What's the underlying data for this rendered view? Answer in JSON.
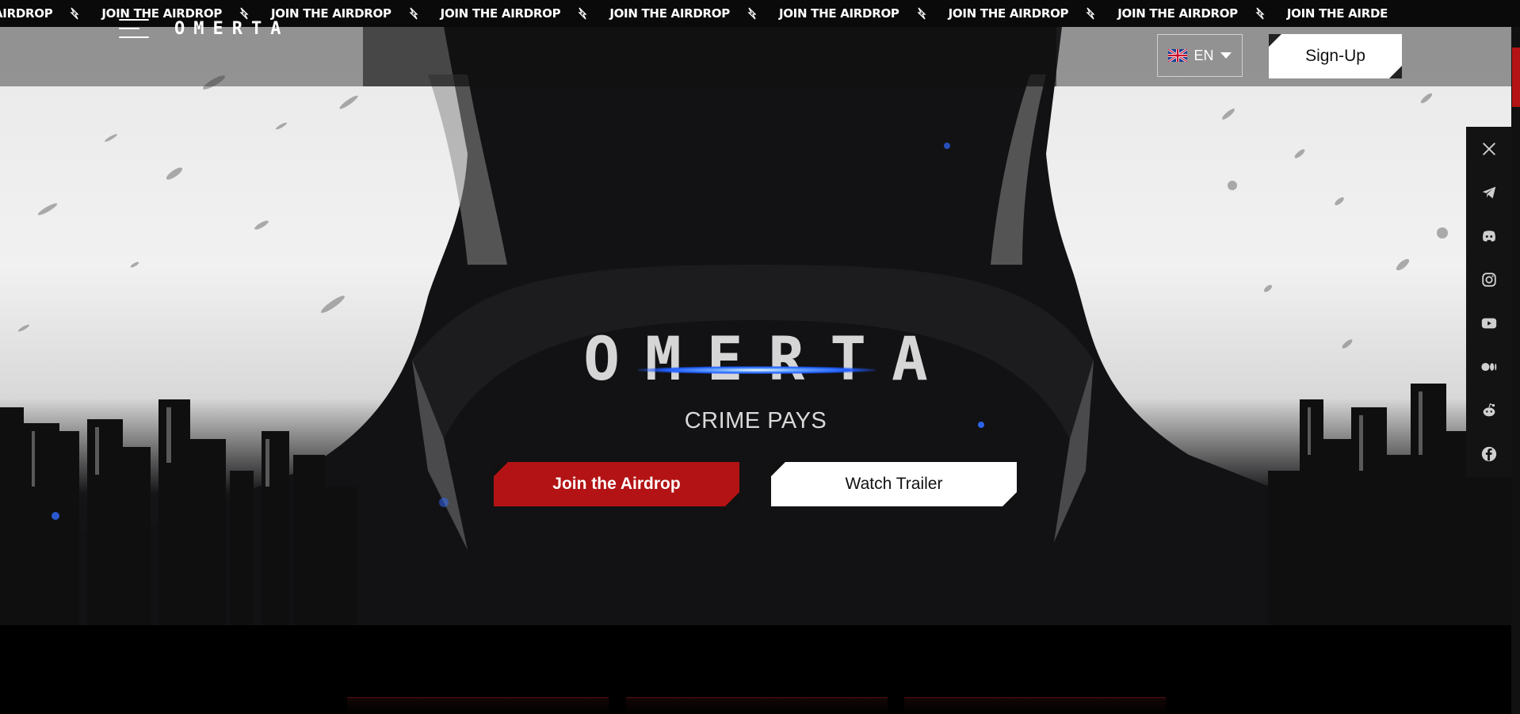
{
  "ticker": {
    "items": [
      {
        "label": "AIRDROP",
        "icon": "bolt-icon"
      },
      {
        "label": "JOIN THE AIRDROP",
        "icon": "bolt-icon"
      },
      {
        "label": "JOIN THE AIRDROP",
        "icon": "bolt-icon"
      },
      {
        "label": "JOIN THE AIRDROP",
        "icon": "bolt-icon"
      },
      {
        "label": "JOIN THE AIRDROP",
        "icon": "bolt-icon"
      },
      {
        "label": "JOIN THE AIRDROP",
        "icon": "bolt-icon"
      },
      {
        "label": "JOIN THE AIRDROP",
        "icon": "bolt-icon"
      },
      {
        "label": "JOIN THE AIRDROP",
        "icon": "bolt-icon"
      },
      {
        "label": "JOIN THE AIRDE"
      }
    ]
  },
  "header": {
    "logo": "OMERTA",
    "language": "EN",
    "language_flag": "uk-flag-icon",
    "signup_label": "Sign-Up"
  },
  "hero": {
    "title": "OMERTA",
    "tagline": "CRIME PAYS",
    "primary_cta": "Join the Airdrop",
    "secondary_cta": "Watch Trailer"
  },
  "social": [
    {
      "name": "x-icon"
    },
    {
      "name": "telegram-icon"
    },
    {
      "name": "discord-icon"
    },
    {
      "name": "instagram-icon"
    },
    {
      "name": "youtube-icon"
    },
    {
      "name": "medium-icon"
    },
    {
      "name": "reddit-icon"
    },
    {
      "name": "facebook-icon"
    }
  ],
  "colors": {
    "accent_red": "#b31314",
    "background": "#0b0b0c",
    "glow_blue": "#1f5bff"
  }
}
